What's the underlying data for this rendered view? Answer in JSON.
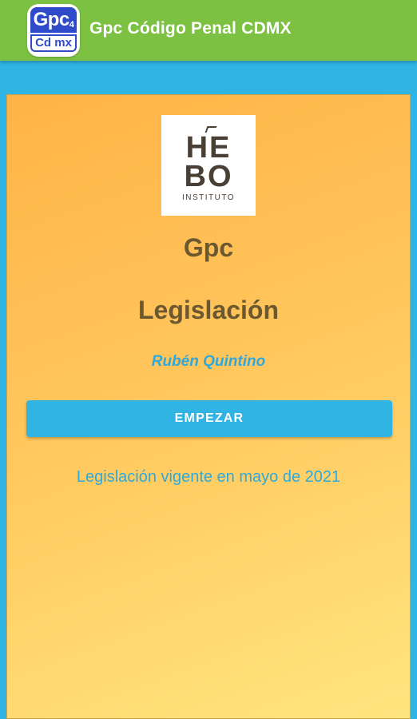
{
  "appbar": {
    "icon_top": "Gpc",
    "icon_sub": "4",
    "icon_bottom": "Cd mx",
    "title": "Gpc Código Penal CDMX"
  },
  "logo": {
    "line1": "HE",
    "line2": "BO",
    "subtitle": "INSTITUTO"
  },
  "main": {
    "title1": "Gpc",
    "title2": "Legislación",
    "author": "Rubén Quintino",
    "start_button": "EMPEZAR",
    "note": "Legislación vigente en mayo de 2021"
  },
  "colors": {
    "appbar": "#7cc141",
    "background": "#2fb4e4",
    "card_top": "#ffb347",
    "card_bottom": "#ffe57e",
    "button": "#2fb4e4",
    "title_text": "#6b5730",
    "link_text": "#2fa9dc"
  }
}
